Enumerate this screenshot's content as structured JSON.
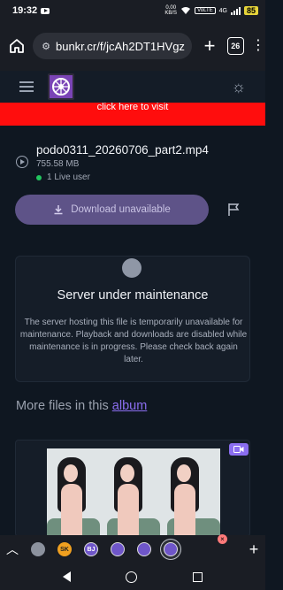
{
  "status_bar": {
    "time": "19:32",
    "net_speed": "0.00",
    "net_unit": "KB/S",
    "volte": "VoLTE",
    "signal": "4G",
    "battery": "85"
  },
  "browser": {
    "url": "bunkr.cr/f/jcAh2DT1HVgz",
    "tab_count": "26"
  },
  "banner": {
    "text": "click here to visit"
  },
  "file": {
    "name": "podo0311_20260706_part2.mp4",
    "size": "755.58 MB",
    "live_users": "1 Live user",
    "download_label": "Download unavailable"
  },
  "maintenance": {
    "title": "Server under maintenance",
    "message": "The server hosting this file is temporarily unavailable for maintenance. Playback and downloads are disabled while maintenance is in progress. Please check back again later."
  },
  "more_files": {
    "prefix": "More files in this",
    "link": "album"
  },
  "tab_strip": {
    "tabs": [
      {
        "label": "",
        "icon": "grey-globe-icon"
      },
      {
        "label": "SK",
        "icon": "sk-favicon"
      },
      {
        "label": "BJ",
        "icon": "bj-favicon"
      },
      {
        "label": "",
        "icon": "purple-favicon"
      },
      {
        "label": "",
        "icon": "purple-favicon"
      },
      {
        "label": "",
        "icon": "purple-favicon-active"
      }
    ]
  },
  "colors": {
    "accent": "#8b6ef0",
    "banner_red": "#ff0d0d",
    "live_green": "#22c55e",
    "download_bg": "#5e5388"
  }
}
